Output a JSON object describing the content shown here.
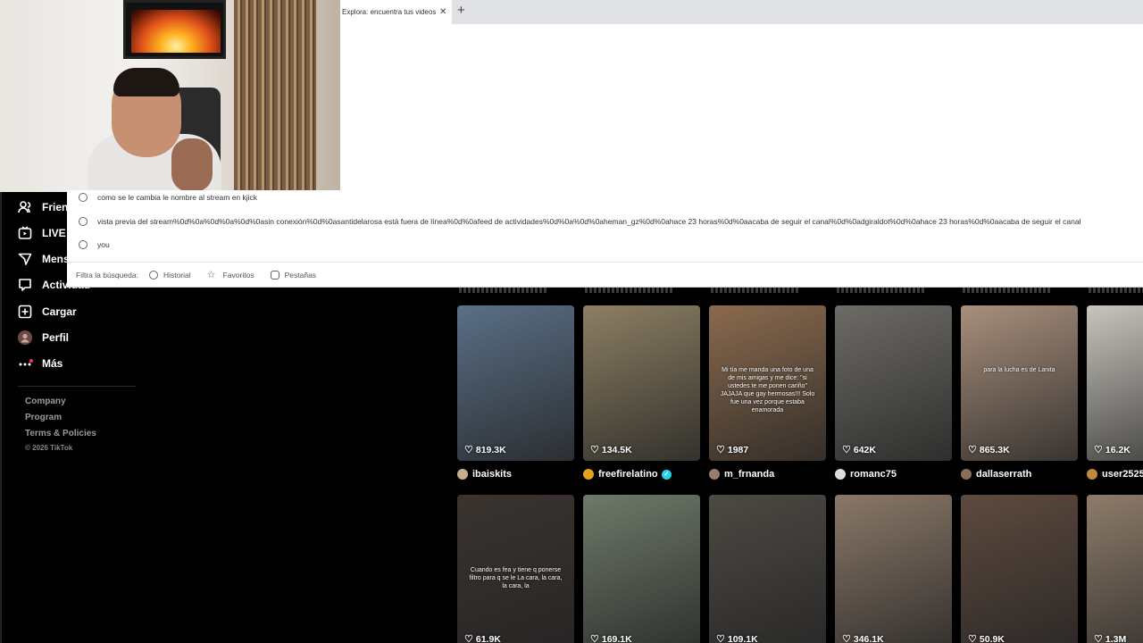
{
  "browser": {
    "tab_title": "Explora: encuentra tus videos",
    "tab_close": "✕",
    "new_tab": "+"
  },
  "omnibox": {
    "suggestions": [
      "como se le cambia le nombre al stream en kjick",
      "vista previa del stream%0d%0a%0d%0a%0d%0asin conexión%0d%0asantidelarosa está fuera de línea%0d%0afeed de actividades%0d%0a%0d%0aheman_gz%0d%0ahace 23 horas%0d%0aacaba de seguir el canal%0d%0adgiraldot%0d%0ahace 23 horas%0d%0aacaba de seguir el canal",
      "you"
    ],
    "filter_label": "Filtra la búsqueda:",
    "filters": [
      "Historial",
      "Favoritos",
      "Pestañas"
    ]
  },
  "sidebar": {
    "items": [
      {
        "label": "Friends",
        "icon": "friends-icon"
      },
      {
        "label": "LIVE",
        "icon": "live-icon"
      },
      {
        "label": "Mensajes",
        "icon": "messages-icon"
      },
      {
        "label": "Actividad",
        "icon": "activity-icon"
      },
      {
        "label": "Cargar",
        "icon": "upload-icon"
      },
      {
        "label": "Perfil",
        "icon": "avatar"
      },
      {
        "label": "Más",
        "icon": "more-icon"
      }
    ],
    "footer": [
      "Company",
      "Program",
      "Terms & Policies"
    ],
    "copyright": "© 2026 TikTok"
  },
  "grid": {
    "row1": [
      {
        "likes": "819.3K",
        "author": "ibaiskits",
        "bg": "#5a6f86",
        "avatar": "#c9b08a"
      },
      {
        "likes": "134.5K",
        "author": "freefirelatino",
        "verified": true,
        "bg": "#8c7f63",
        "avatar": "#e3a41b"
      },
      {
        "likes": "1987",
        "author": "m_frnanda",
        "bg": "#8b6a4e",
        "avatar": "#9a7c6a",
        "overlay": "Mi tía me manda una foto de una de mis amigas y me dice: \"si ustedes te me ponen cariño\" JAJAJA que gay hermosas!!! Solo fue una vez porque estaba enamorada"
      },
      {
        "likes": "642K",
        "author": "romanc75",
        "bg": "#6d6b66",
        "avatar": "#dddddd"
      },
      {
        "likes": "865.3K",
        "author": "dallaserrath",
        "bg": "#a88f7c",
        "avatar": "#8b6e58",
        "overlay": "para la lucha es de Lanita"
      },
      {
        "likes": "16.2K",
        "author": "user2525",
        "bg": "#c8c5bd",
        "avatar": "#c08a3a"
      }
    ],
    "row2": [
      {
        "likes": "61.9K",
        "author": "",
        "bg": "#3a3430",
        "overlay": "Cuando es fea y tiene q ponerse filtro para q se le La cara, la cara, la cara, la"
      },
      {
        "likes": "169.1K",
        "author": "",
        "bg": "#6f7a6a"
      },
      {
        "likes": "109.1K",
        "author": "",
        "bg": "#4d4944"
      },
      {
        "likes": "346.1K",
        "author": "",
        "bg": "#8a7868"
      },
      {
        "likes": "50.9K",
        "author": "",
        "bg": "#5e4a3e"
      },
      {
        "likes": "1.3M",
        "author": "",
        "bg": "#8e7c6a"
      }
    ]
  }
}
